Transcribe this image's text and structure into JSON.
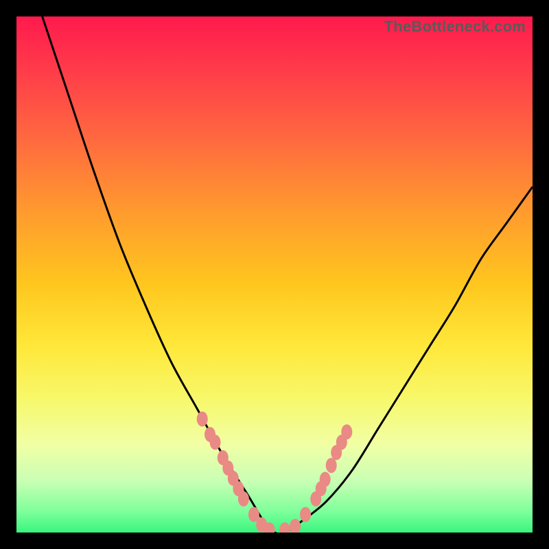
{
  "watermark": "TheBottleneck.com",
  "chart_data": {
    "type": "line",
    "title": "",
    "xlabel": "",
    "ylabel": "",
    "xlim": [
      0,
      100
    ],
    "ylim": [
      0,
      100
    ],
    "grid": false,
    "legend": false,
    "series": [
      {
        "name": "bottleneck-curve",
        "x": [
          5,
          10,
          15,
          20,
          25,
          30,
          35,
          40,
          45,
          48,
          50,
          52,
          55,
          60,
          65,
          70,
          75,
          80,
          85,
          90,
          95,
          100
        ],
        "values": [
          100,
          85,
          70,
          56,
          44,
          33,
          24,
          15,
          7,
          2,
          0,
          0,
          2,
          6,
          12,
          20,
          28,
          36,
          44,
          53,
          60,
          67
        ]
      }
    ],
    "markers": {
      "name": "highlight-beads",
      "points": [
        {
          "x": 36,
          "y": 22
        },
        {
          "x": 37.5,
          "y": 19
        },
        {
          "x": 38.5,
          "y": 17.5
        },
        {
          "x": 40,
          "y": 14.5
        },
        {
          "x": 41,
          "y": 12.5
        },
        {
          "x": 42,
          "y": 10.5
        },
        {
          "x": 43,
          "y": 8.5
        },
        {
          "x": 44,
          "y": 6.5
        },
        {
          "x": 46,
          "y": 3.5
        },
        {
          "x": 47.5,
          "y": 1.5
        },
        {
          "x": 49,
          "y": 0.5
        },
        {
          "x": 52,
          "y": 0.5
        },
        {
          "x": 54,
          "y": 1.2
        },
        {
          "x": 56,
          "y": 3.5
        },
        {
          "x": 58,
          "y": 6.5
        },
        {
          "x": 59,
          "y": 8.5
        },
        {
          "x": 59.8,
          "y": 10.3
        },
        {
          "x": 61,
          "y": 13
        },
        {
          "x": 62,
          "y": 15.5
        },
        {
          "x": 63,
          "y": 17.5
        },
        {
          "x": 64,
          "y": 19.5
        }
      ]
    }
  }
}
